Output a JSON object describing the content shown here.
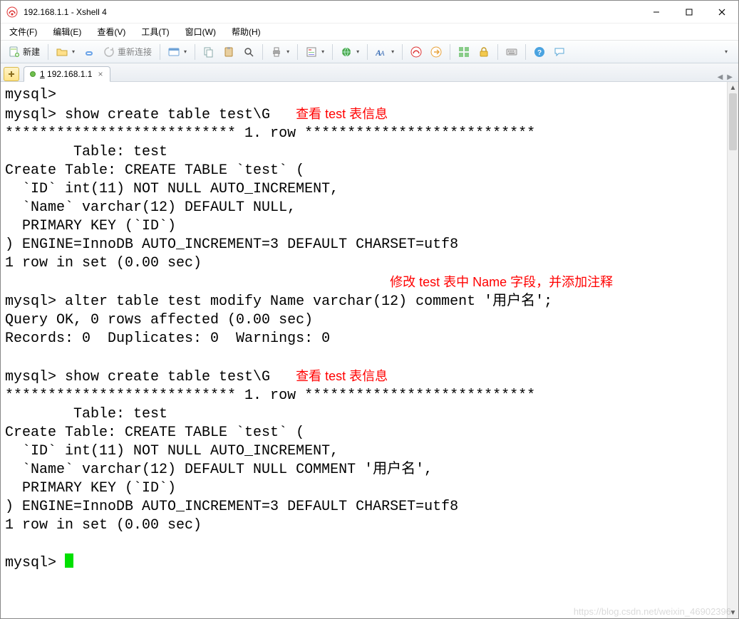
{
  "title": "192.168.1.1 - Xshell 4",
  "menus": [
    "文件(F)",
    "编辑(E)",
    "查看(V)",
    "工具(T)",
    "窗口(W)",
    "帮助(H)"
  ],
  "toolbar": {
    "new_label": "新建",
    "reconnect_label": "重新连接"
  },
  "tab": {
    "number": "1",
    "label": "192.168.1.1"
  },
  "annotations": {
    "a1": "查看 test 表信息",
    "a2": "修改 test 表中 Name 字段，并添加注释",
    "a3": "查看 test 表信息"
  },
  "terminal_lines": {
    "l01": "mysql>",
    "l02a": "mysql> show create table test\\G",
    "sep1": "*************************** 1. row ***************************",
    "l03": "        Table: test",
    "l04": "Create Table: CREATE TABLE `test` (",
    "l05": "  `ID` int(11) NOT NULL AUTO_INCREMENT,",
    "l06": "  `Name` varchar(12) DEFAULT NULL,",
    "l07": "  PRIMARY KEY (`ID`)",
    "l08": ") ENGINE=InnoDB AUTO_INCREMENT=3 DEFAULT CHARSET=utf8",
    "l09": "1 row in set (0.00 sec)",
    "blank": " ",
    "l10": "mysql> alter table test modify Name varchar(12) comment '用户名';",
    "l11": "Query OK, 0 rows affected (0.00 sec)",
    "l12": "Records: 0  Duplicates: 0  Warnings: 0",
    "l13a": "mysql> show create table test\\G",
    "sep2": "*************************** 1. row ***************************",
    "l14": "        Table: test",
    "l15": "Create Table: CREATE TABLE `test` (",
    "l16": "  `ID` int(11) NOT NULL AUTO_INCREMENT,",
    "l17": "  `Name` varchar(12) DEFAULT NULL COMMENT '用户名',",
    "l18": "  PRIMARY KEY (`ID`)",
    "l19": ") ENGINE=InnoDB AUTO_INCREMENT=3 DEFAULT CHARSET=utf8",
    "l20": "1 row in set (0.00 sec)",
    "prompt": "mysql> "
  },
  "watermark": "https://blog.csdn.net/weixin_46902396"
}
